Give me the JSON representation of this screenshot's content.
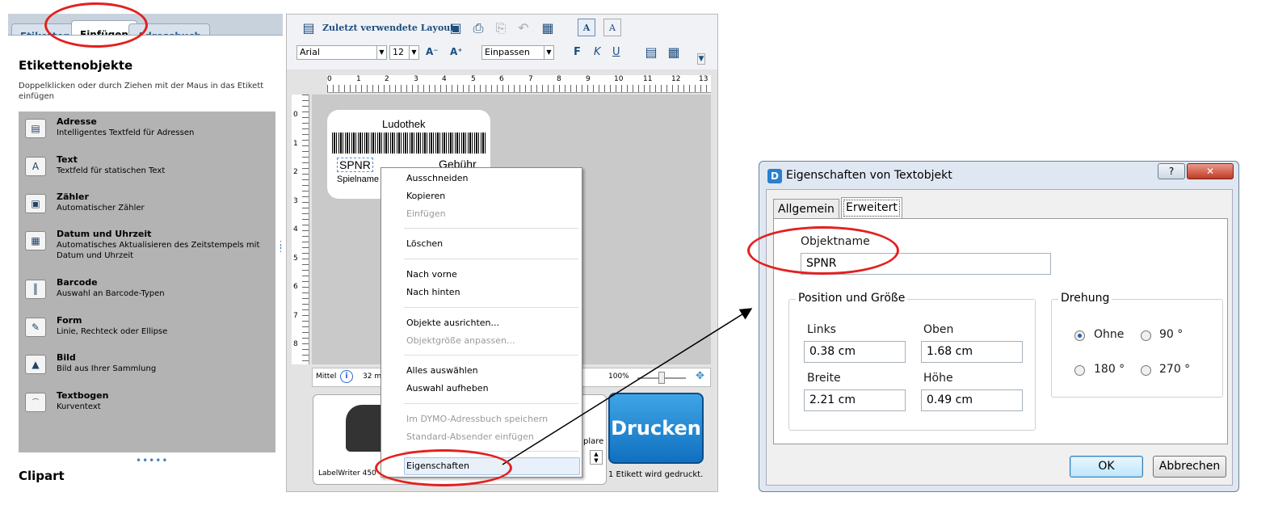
{
  "left_panel": {
    "tabs": [
      "Etiketten",
      "Einfügen",
      "Adressbuch"
    ],
    "title": "Etikettenobjekte",
    "description": "Doppelklicken oder durch Ziehen mit der Maus in das Etikett einfügen",
    "items": [
      {
        "title": "Adresse",
        "desc": "Intelligentes Textfeld für Adressen",
        "icon": "address-icon"
      },
      {
        "title": "Text",
        "desc": "Textfeld für statischen Text",
        "icon": "text-icon"
      },
      {
        "title": "Zähler",
        "desc": "Automatischer Zähler",
        "icon": "counter-icon"
      },
      {
        "title": "Datum und Uhrzeit",
        "desc": "Automatisches Aktualisieren des Zeitstempels mit Datum und Uhrzeit",
        "icon": "calendar-icon"
      },
      {
        "title": "Barcode",
        "desc": "Auswahl an Barcode-Typen",
        "icon": "barcode-icon"
      },
      {
        "title": "Form",
        "desc": "Linie, Rechteck oder Ellipse",
        "icon": "shape-icon"
      },
      {
        "title": "Bild",
        "desc": "Bild aus Ihrer Sammlung",
        "icon": "image-icon"
      },
      {
        "title": "Textbogen",
        "desc": "Kurventext",
        "icon": "curved-text-icon"
      }
    ],
    "clipart": "Clipart"
  },
  "editor": {
    "recent_layouts": "Zuletzt verwendete Layouts",
    "font": "Arial",
    "size": "12",
    "fit": "Einpassen",
    "ruler_ticks": [
      "0",
      "1",
      "2",
      "3",
      "4",
      "5",
      "6",
      "7",
      "8",
      "9",
      "10",
      "11",
      "12",
      "13"
    ],
    "vruler_ticks": [
      "0",
      "1",
      "2",
      "3",
      "4",
      "5",
      "6",
      "7",
      "8"
    ],
    "label": {
      "title": "Ludothek",
      "spnr": "SPNR",
      "fee": "Gebühr",
      "name": "Spielname"
    },
    "status_mid": "Mittel",
    "status_size": "32 m",
    "zoom": "100%",
    "printer": "LabelWriter 450",
    "copies_label": "plare",
    "print_button": "Drucken",
    "print_info": "1 Etikett wird gedruckt."
  },
  "context_menu": [
    {
      "label": "Ausschneiden",
      "disabled": false
    },
    {
      "label": "Kopieren",
      "disabled": false
    },
    {
      "label": "Einfügen",
      "disabled": true
    },
    {
      "label": "Löschen",
      "disabled": false
    },
    {
      "label": "Nach vorne",
      "disabled": false
    },
    {
      "label": "Nach hinten",
      "disabled": false
    },
    {
      "label": "Objekte ausrichten...",
      "disabled": false
    },
    {
      "label": "Objektgröße anpassen...",
      "disabled": true
    },
    {
      "label": "Alles auswählen",
      "disabled": false
    },
    {
      "label": "Auswahl aufheben",
      "disabled": false
    },
    {
      "label": "Im DYMO-Adressbuch speichern",
      "disabled": true
    },
    {
      "label": "Standard-Absender einfügen",
      "disabled": true
    },
    {
      "label": "Eigenschaften",
      "disabled": false
    }
  ],
  "dialog": {
    "title": "Eigenschaften von Textobjekt",
    "help": "?",
    "close": "✕",
    "tabs": [
      "Allgemein",
      "Erweitert"
    ],
    "object_name_label": "Objektname",
    "object_name_value": "SPNR",
    "position_group": "Position und Größe",
    "links_label": "Links",
    "links_value": "0.38 cm",
    "oben_label": "Oben",
    "oben_value": "1.68 cm",
    "breite_label": "Breite",
    "breite_value": "2.21 cm",
    "hoehe_label": "Höhe",
    "hoehe_value": "0.49 cm",
    "rotation_group": "Drehung",
    "rotation_options": [
      "Ohne",
      "90 °",
      "180 °",
      "270 °"
    ],
    "rotation_selected": "Ohne",
    "ok": "OK",
    "cancel": "Abbrechen"
  },
  "colors": {
    "highlight": "#e32020",
    "accent": "#1e4d80",
    "print_button": "#1a84d4"
  }
}
